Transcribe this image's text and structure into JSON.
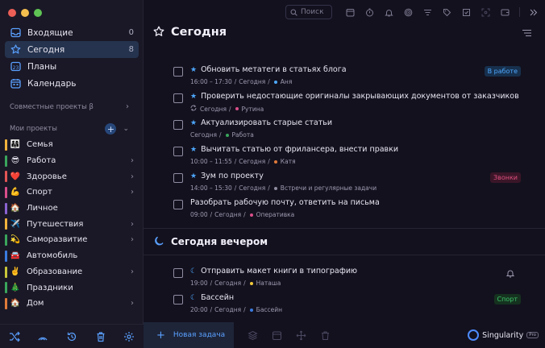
{
  "window": {
    "traffic_colors": [
      "#ec5f57",
      "#f3be4e",
      "#5fc454"
    ]
  },
  "sidebar": {
    "nav": [
      {
        "label": "Входящие",
        "count": "0",
        "icon": "inbox-icon"
      },
      {
        "label": "Сегодня",
        "count": "8",
        "icon": "star-icon",
        "active": true
      },
      {
        "label": "Планы",
        "count": "",
        "icon": "plans-icon"
      },
      {
        "label": "Календарь",
        "count": "",
        "icon": "calendar-icon"
      }
    ],
    "shared_label": "Совместные проекты β",
    "my_projects_label": "Мои проекты",
    "projects": [
      {
        "emoji": "👨‍👩‍👧",
        "label": "Семья",
        "color": "#f0b13c",
        "chevron": false
      },
      {
        "emoji": "😎",
        "label": "Работа",
        "color": "#3aa55c",
        "chevron": true
      },
      {
        "emoji": "❤️",
        "label": "Здоровье",
        "color": "#e25555",
        "chevron": true
      },
      {
        "emoji": "💪",
        "label": "Спорт",
        "color": "#d94e8a",
        "chevron": true
      },
      {
        "emoji": "🏠",
        "label": "Личное",
        "color": "#8a63d2",
        "chevron": false
      },
      {
        "emoji": "✈️",
        "label": "Путешествия",
        "color": "#f0b13c",
        "chevron": true
      },
      {
        "emoji": "💫",
        "label": "Саморазвитие",
        "color": "#3aa55c",
        "chevron": true
      },
      {
        "emoji": "🚘",
        "label": "Автомобиль",
        "color": "#3a7be0",
        "chevron": false
      },
      {
        "emoji": "✌️",
        "label": "Образование",
        "color": "#c9c63a",
        "chevron": true
      },
      {
        "emoji": "🎄",
        "label": "Праздники",
        "color": "#3aa55c",
        "chevron": false
      },
      {
        "emoji": "🏠",
        "label": "Дом",
        "color": "#e07a3a",
        "chevron": true
      }
    ],
    "bottom_icons": [
      "shuffle-icon",
      "signal-icon",
      "history-icon",
      "trash-icon",
      "settings-icon"
    ]
  },
  "topbar": {
    "search_placeholder": "Поиск"
  },
  "main": {
    "title": "Сегодня",
    "tasks": [
      {
        "title": "Обновить метатеги в статьях блога",
        "meta_time": "16:00 – 17:30",
        "meta_day": "Сегодня",
        "project": "Аня",
        "dot": "#4ea8ff",
        "badge": "В работе",
        "badge_bg": "#17304d",
        "badge_fg": "#4ea8ff",
        "star": true
      },
      {
        "title": "Проверить недостающие оригиналы закрывающих документов от заказчиков",
        "meta_time": "",
        "meta_day": "Сегодня",
        "project": "Рутина",
        "dot": "#d94e8a",
        "badge": "",
        "star": true,
        "repeat": true
      },
      {
        "title": "Актуализировать старые статьи",
        "meta_time": "",
        "meta_day": "Сегодня",
        "project": "Работа",
        "dot": "#3aa55c",
        "badge": "",
        "star": true
      },
      {
        "title": "Вычитать статью от фрилансера, внести правки",
        "meta_time": "10:00 – 11:55",
        "meta_day": "Сегодня",
        "project": "Катя",
        "dot": "#e07a3a",
        "badge": "",
        "star": true
      },
      {
        "title": "Зум по проекту",
        "meta_time": "14:00 – 15:30",
        "meta_day": "Сегодня",
        "project": "Встречи и регулярные задачи",
        "dot": "#8e8ca0",
        "badge": "Звонки",
        "badge_bg": "#3a1628",
        "badge_fg": "#e0507f",
        "star": true
      },
      {
        "title": "Разобрать рабочую почту, ответить на письма",
        "meta_time": "09:00",
        "meta_day": "Сегодня",
        "project": "Оперативка",
        "dot": "#d94e8a",
        "badge": "",
        "star": false
      }
    ],
    "evening_title": "Сегодня вечером",
    "evening_tasks": [
      {
        "title": "Отправить макет книги в типографию",
        "meta_time": "19:00",
        "meta_day": "Сегодня",
        "project": "Наташа",
        "dot": "#f0c93c",
        "badge": "",
        "bell": true
      },
      {
        "title": "Бассейн",
        "meta_time": "20:00",
        "meta_day": "Сегодня",
        "project": "Бассейн",
        "dot": "#3a7be0",
        "badge": "Спорт",
        "badge_bg": "#15321f",
        "badge_fg": "#3ec46a"
      }
    ]
  },
  "bottombar": {
    "new_task_label": "Новая задача",
    "brand": "Singularity",
    "brand_badge": "Pro"
  }
}
